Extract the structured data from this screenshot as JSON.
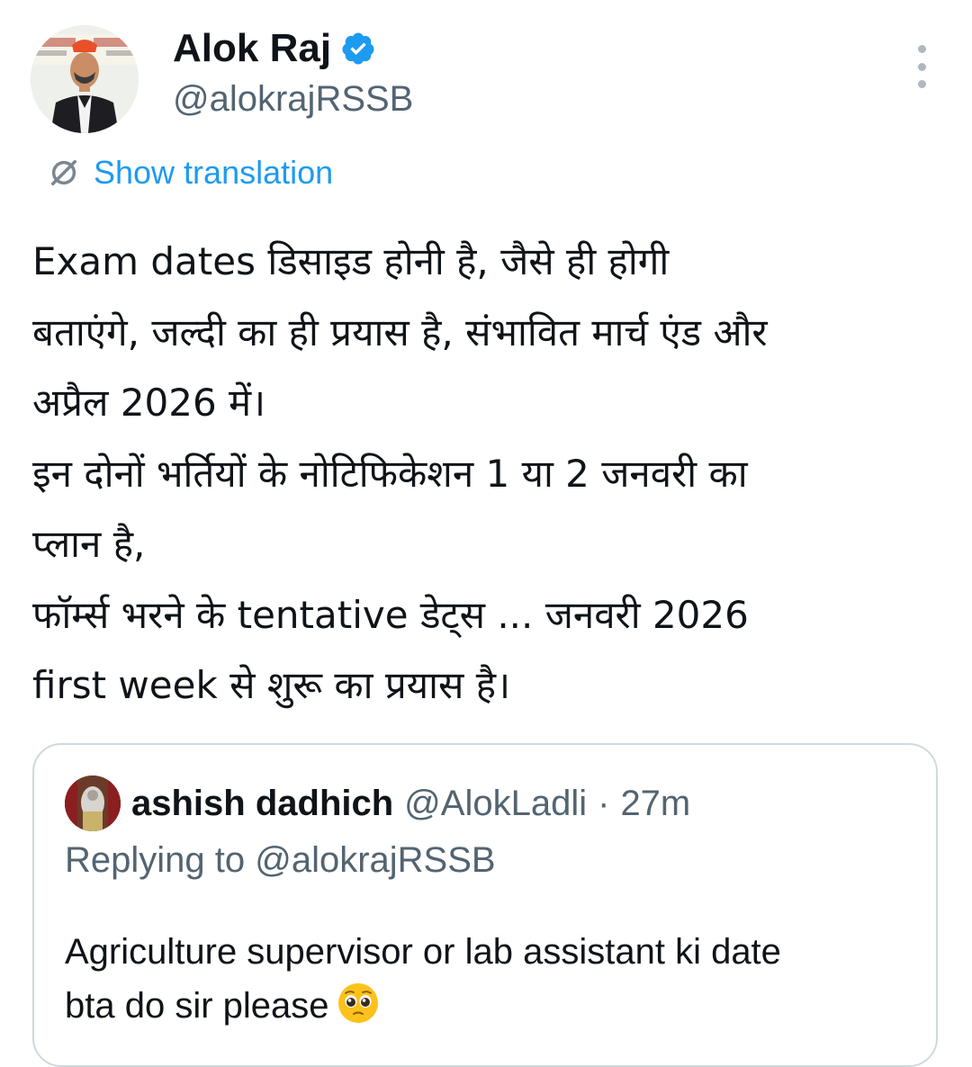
{
  "tweet": {
    "author": {
      "display_name": "Alok Raj",
      "handle": "@alokrajRSSB",
      "verified": true,
      "avatar_icon": "profile-photo"
    },
    "more_icon": "more-vertical-icon",
    "translation": {
      "icon": "translate-icon",
      "label": "Show translation"
    },
    "text_lines": [
      "Exam dates डिसाइड होनी है, जैसे ही होगी",
      "बताएंगे, जल्दी का ही प्रयास है, संभावित मार्च एंड और",
      "अप्रैल 2026 में।",
      "इन दोनों भर्तियों के नोटिफिकेशन 1 या 2 जनवरी का",
      "प्लान है,",
      "फॉर्म्स भरने के tentative डेट्स ... जनवरी 2026",
      "first week से शुरू का प्रयास है।"
    ]
  },
  "quoted_tweet": {
    "author_name": "ashish dadhich",
    "author_handle": "@AlokLadli",
    "separator": "·",
    "time": "27m",
    "replying_to": "Replying to @alokrajRSSB",
    "text_lines": [
      "Agriculture supervisor or lab assistant ki date",
      "bta do sir please"
    ],
    "emoji": "pleading-face-emoji"
  },
  "colors": {
    "accent": "#1d9bf0",
    "secondary_text": "#536471",
    "primary_text": "#0f1419",
    "border": "#cfd9de"
  }
}
